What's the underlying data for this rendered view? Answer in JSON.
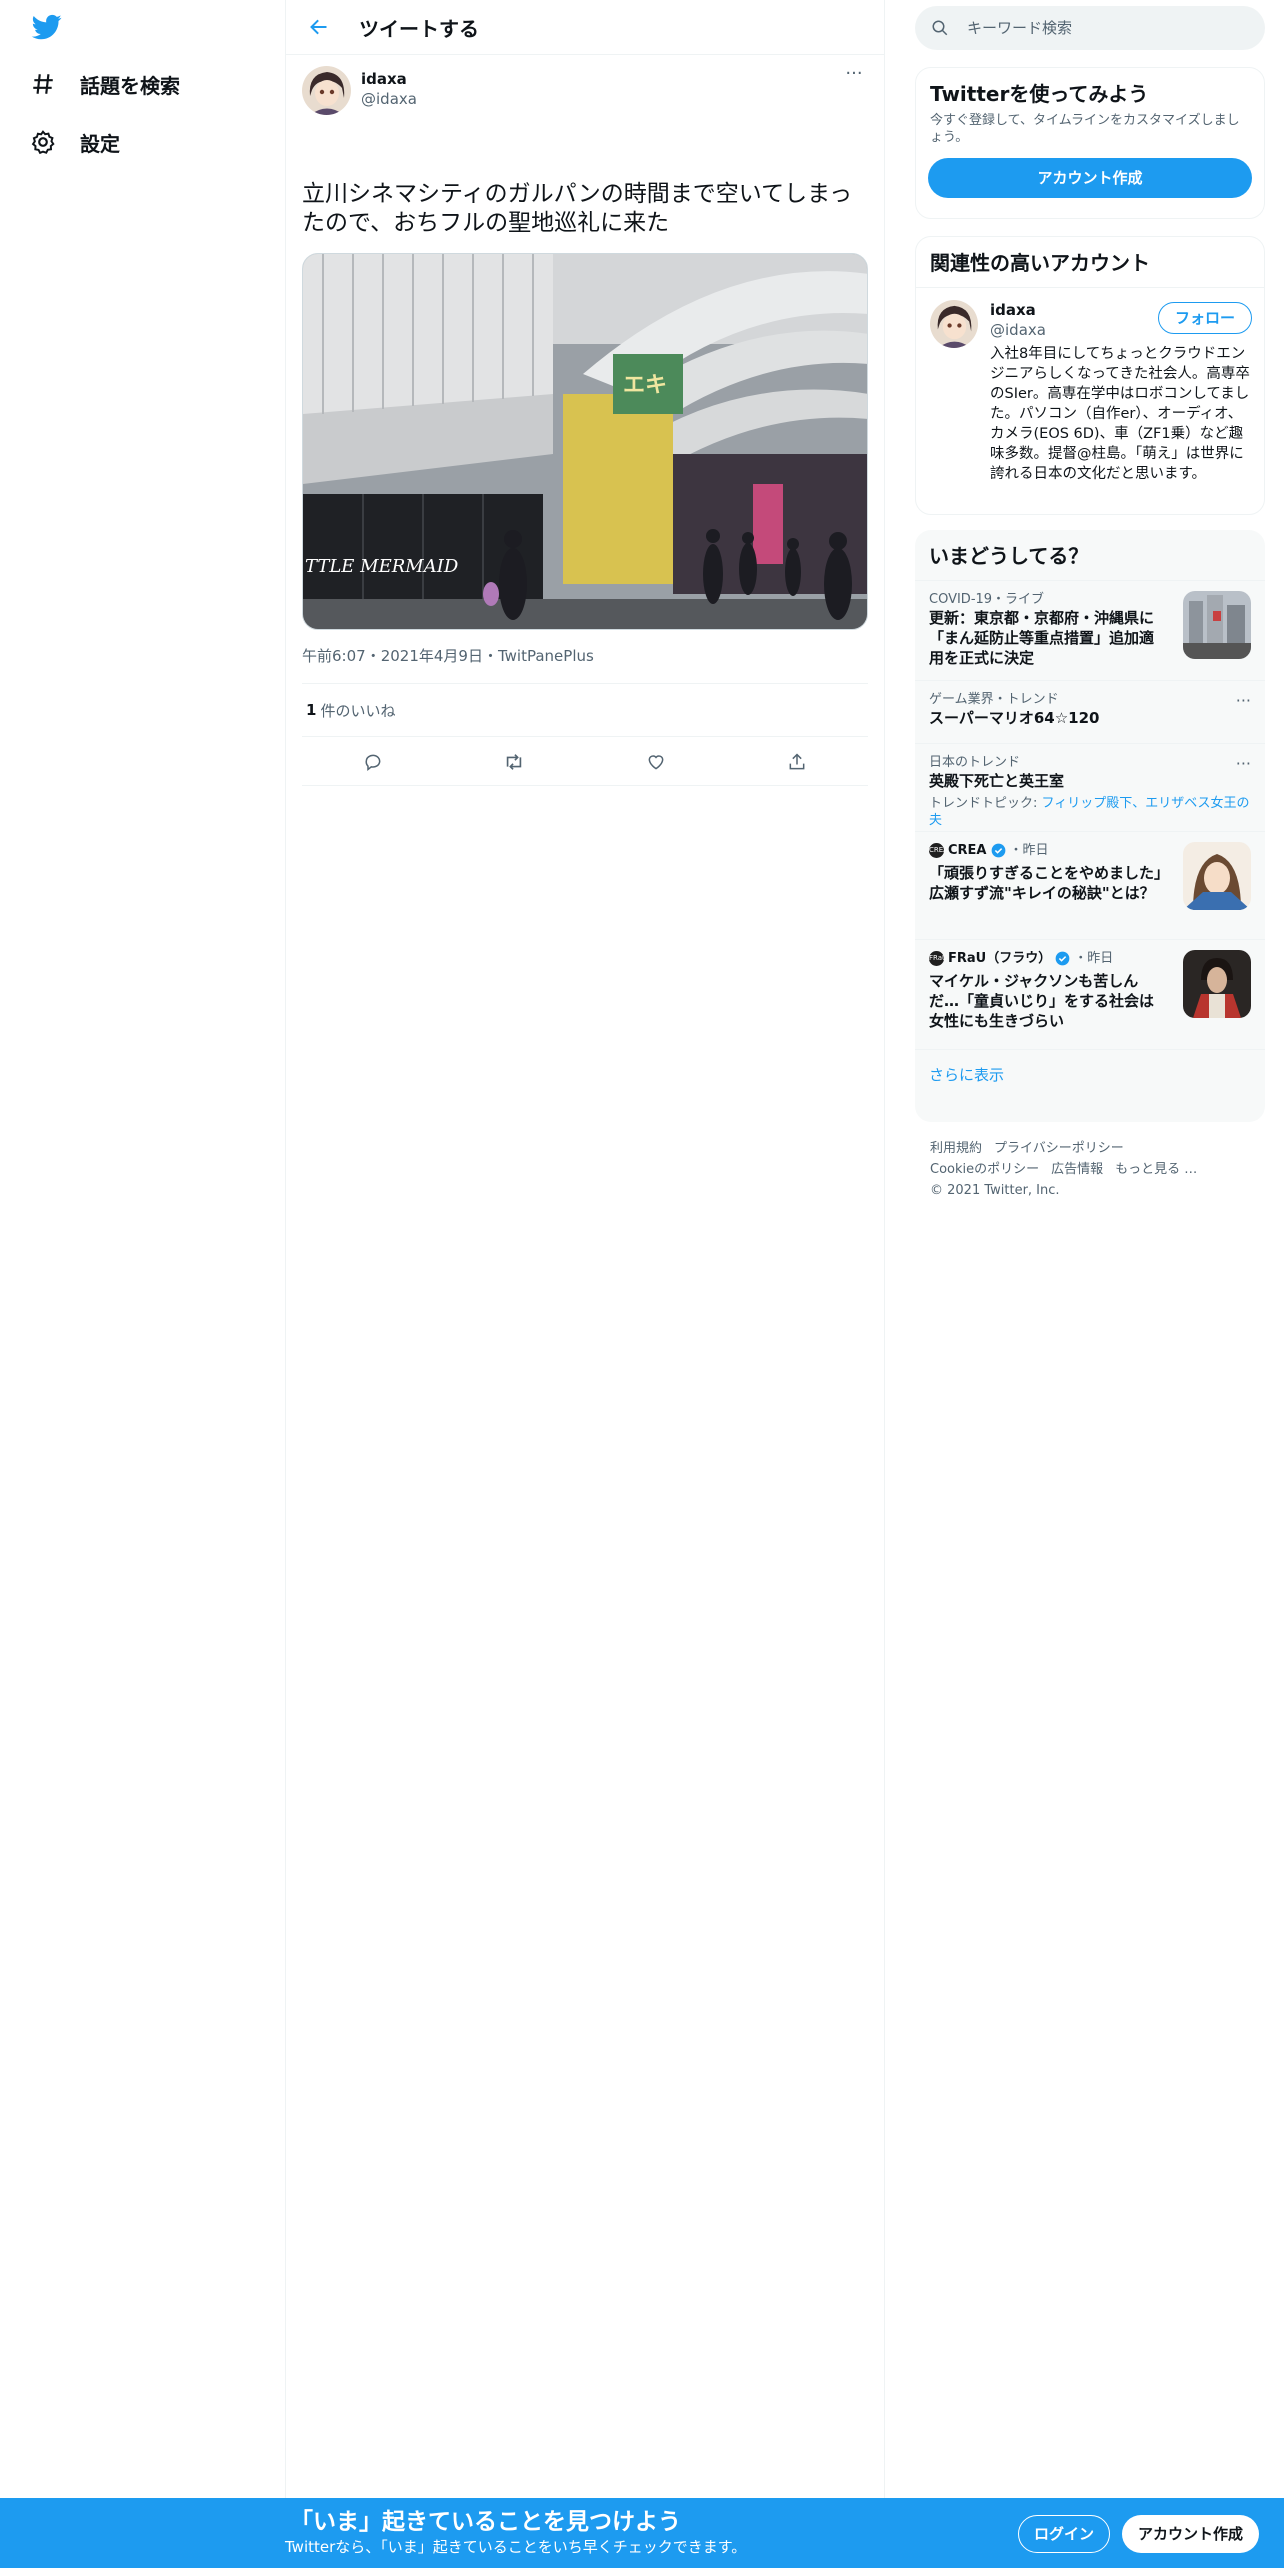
{
  "colors": {
    "accent": "#1d9bf0",
    "text": "#0f1419",
    "secondary": "#536471",
    "border": "#eff3f4"
  },
  "sidebar": {
    "logo_icon": "twitter-bird-icon",
    "items": [
      {
        "icon": "hashtag-icon",
        "label": "話題を検索"
      },
      {
        "icon": "gear-icon",
        "label": "設定"
      }
    ]
  },
  "header": {
    "back_icon": "arrow-left-icon",
    "title": "ツイートする"
  },
  "tweet": {
    "author_name": "idaxa",
    "author_handle": "@idaxa",
    "more_icon": "more-dots-icon",
    "text": "立川シネマシティのガルパンの時間まで空いてしまったので、おちフルの聖地巡礼に来た",
    "photo_sign": "TTLE MERMAID",
    "time": "午前6:07",
    "date": "2021年4月9日",
    "source": "TwitPanePlus",
    "sep": "・",
    "likes_count": "1",
    "likes_label": "件のいいね",
    "actions": [
      "reply-icon",
      "retweet-icon",
      "like-icon",
      "share-icon"
    ]
  },
  "right": {
    "search": {
      "placeholder": "キーワード検索",
      "icon": "search-icon"
    },
    "signup_card": {
      "title": "Twitterを使ってみよう",
      "sub": "今すぐ登録して、タイムラインをカスタマイズしましょう。",
      "button": "アカウント作成"
    },
    "related": {
      "title": "関連性の高いアカウント",
      "name": "idaxa",
      "handle": "@idaxa",
      "follow": "フォロー",
      "bio": "入社8年目にしてちょっとクラウドエンジニアらしくなってきた社会人。高専卒のSIer。高専在学中はロボコンしてました。パソコン（自作er）、オーディオ、カメラ(EOS 6D)、車（ZF1乗）など趣味多数。提督@柱島。「萌え」は世界に誇れる日本の文化だと思います。"
    },
    "trends": {
      "title": "いまどうしてる？",
      "items": [
        {
          "meta": "COVID-19・ライブ",
          "title": "更新：東京都・京都府・沖縄県に「まん延防止等重点措置」追加適用を正式に決定"
        },
        {
          "meta": "ゲーム業界・トレンド",
          "title": "スーパーマリオ64☆120"
        },
        {
          "meta": "日本のトレンド",
          "title": "英殿下死亡と英王室",
          "extra_prefix": "トレンドトピック: ",
          "extra_links": "フィリップ殿下、エリザベス女王の夫"
        },
        {
          "source": "CREA",
          "source_icon_text": "CREA",
          "time": "・昨日",
          "title": "「頑張りすぎることをやめました」　広瀬すず流\"キレイの秘訣\"とは？"
        },
        {
          "source": "FRaU（フラウ）",
          "source_icon_text": "FRaU",
          "time": "・昨日",
          "title": "マイケル・ジャクソンも苦しんだ…「童貞いじり」をする社会は女性にも生きづらい"
        }
      ],
      "show_more": "さらに表示"
    },
    "footer": {
      "links1": [
        "利用規約",
        "プライバシーポリシー"
      ],
      "links2": [
        "Cookieのポリシー",
        "広告情報",
        "もっと見る …"
      ],
      "copyright": "© 2021 Twitter, Inc."
    }
  },
  "bottom_bar": {
    "title": "「いま」起きていることを見つけよう",
    "sub": "Twitterなら、「いま」起きていることをいち早くチェックできます。",
    "login": "ログイン",
    "signup": "アカウント作成"
  }
}
